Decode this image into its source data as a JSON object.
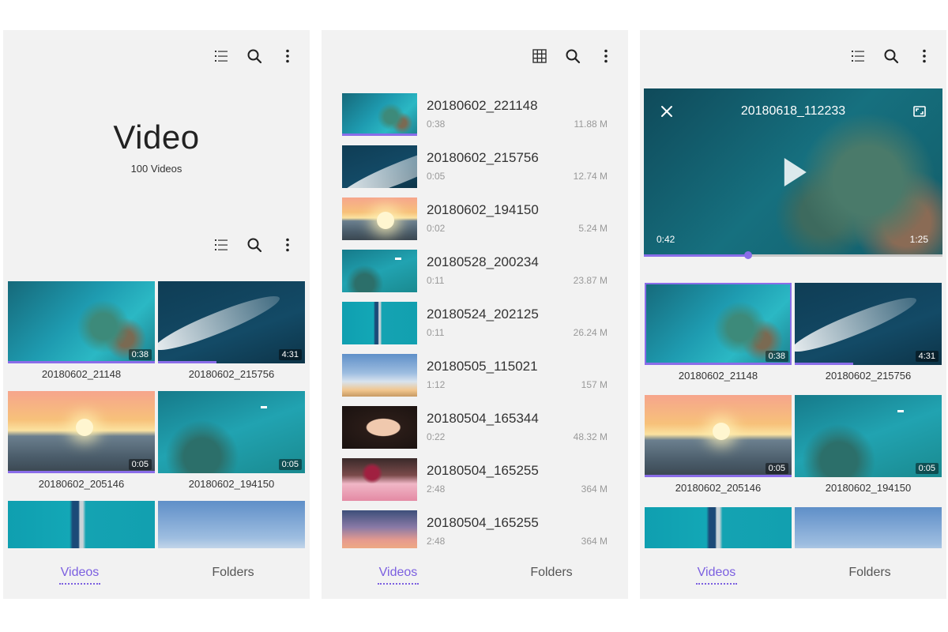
{
  "screens": {
    "grid": {
      "title": "Video",
      "count": "100 Videos",
      "tiles": [
        {
          "label": "20180602_21148",
          "duration": "0:38",
          "art": "t-ocean",
          "progress": 1.0
        },
        {
          "label": "20180602_215756",
          "duration": "4:31",
          "art": "t-boat",
          "progress": 0.4
        },
        {
          "label": "20180602_205146",
          "duration": "0:05",
          "art": "t-sunset",
          "progress": 1.0
        },
        {
          "label": "20180602_194150",
          "duration": "0:05",
          "art": "t-reef",
          "progress": 0
        },
        {
          "label": "",
          "duration": "",
          "art": "t-pier",
          "progress": 0
        },
        {
          "label": "",
          "duration": "",
          "art": "t-sky",
          "progress": 0
        }
      ]
    },
    "list": {
      "rows": [
        {
          "name": "20180602_221148",
          "duration": "0:38",
          "size": "11.88 M",
          "art": "t-ocean",
          "progress": 1.0
        },
        {
          "name": "20180602_215756",
          "duration": "0:05",
          "size": "12.74 M",
          "art": "t-boat",
          "progress": 0
        },
        {
          "name": "20180602_194150",
          "duration": "0:02",
          "size": "5.24 M",
          "art": "t-sunset",
          "progress": 0
        },
        {
          "name": "20180528_200234",
          "duration": "0:11",
          "size": "23.87 M",
          "art": "t-reef",
          "progress": 0
        },
        {
          "name": "20180524_202125",
          "duration": "0:11",
          "size": "26.24 M",
          "art": "t-pier",
          "progress": 0
        },
        {
          "name": "20180505_115021",
          "duration": "1:12",
          "size": "157 M",
          "art": "t-sky",
          "progress": 0
        },
        {
          "name": "20180504_165344",
          "duration": "0:22",
          "size": "48.32 M",
          "art": "t-face",
          "progress": 0
        },
        {
          "name": "20180504_165255",
          "duration": "2:48",
          "size": "364 M",
          "art": "t-cake",
          "progress": 0
        },
        {
          "name": "20180504_165255",
          "duration": "2:48",
          "size": "364 M",
          "art": "t-dusk",
          "progress": 0
        }
      ]
    },
    "player": {
      "title": "20180618_112233",
      "current": "0:42",
      "total": "1:25",
      "progress": 0.35,
      "tiles": [
        {
          "label": "20180602_21148",
          "duration": "0:38",
          "art": "t-ocean",
          "progress": 1.0,
          "selected": true
        },
        {
          "label": "20180602_215756",
          "duration": "4:31",
          "art": "t-boat",
          "progress": 0.4
        },
        {
          "label": "20180602_205146",
          "duration": "0:05",
          "art": "t-sunset",
          "progress": 1.0
        },
        {
          "label": "20180602_194150",
          "duration": "0:05",
          "art": "t-reef",
          "progress": 0
        },
        {
          "label": "",
          "duration": "",
          "art": "t-pier",
          "progress": 0
        },
        {
          "label": "",
          "duration": "",
          "art": "t-sky",
          "progress": 0
        }
      ]
    }
  },
  "nav": {
    "videos": "Videos",
    "folders": "Folders"
  },
  "colors": {
    "accent": "#8a6de9"
  },
  "icons": [
    "list-view-icon",
    "grid-view-icon",
    "search-icon",
    "more-icon",
    "close-icon",
    "fullscreen-icon",
    "play-icon"
  ]
}
